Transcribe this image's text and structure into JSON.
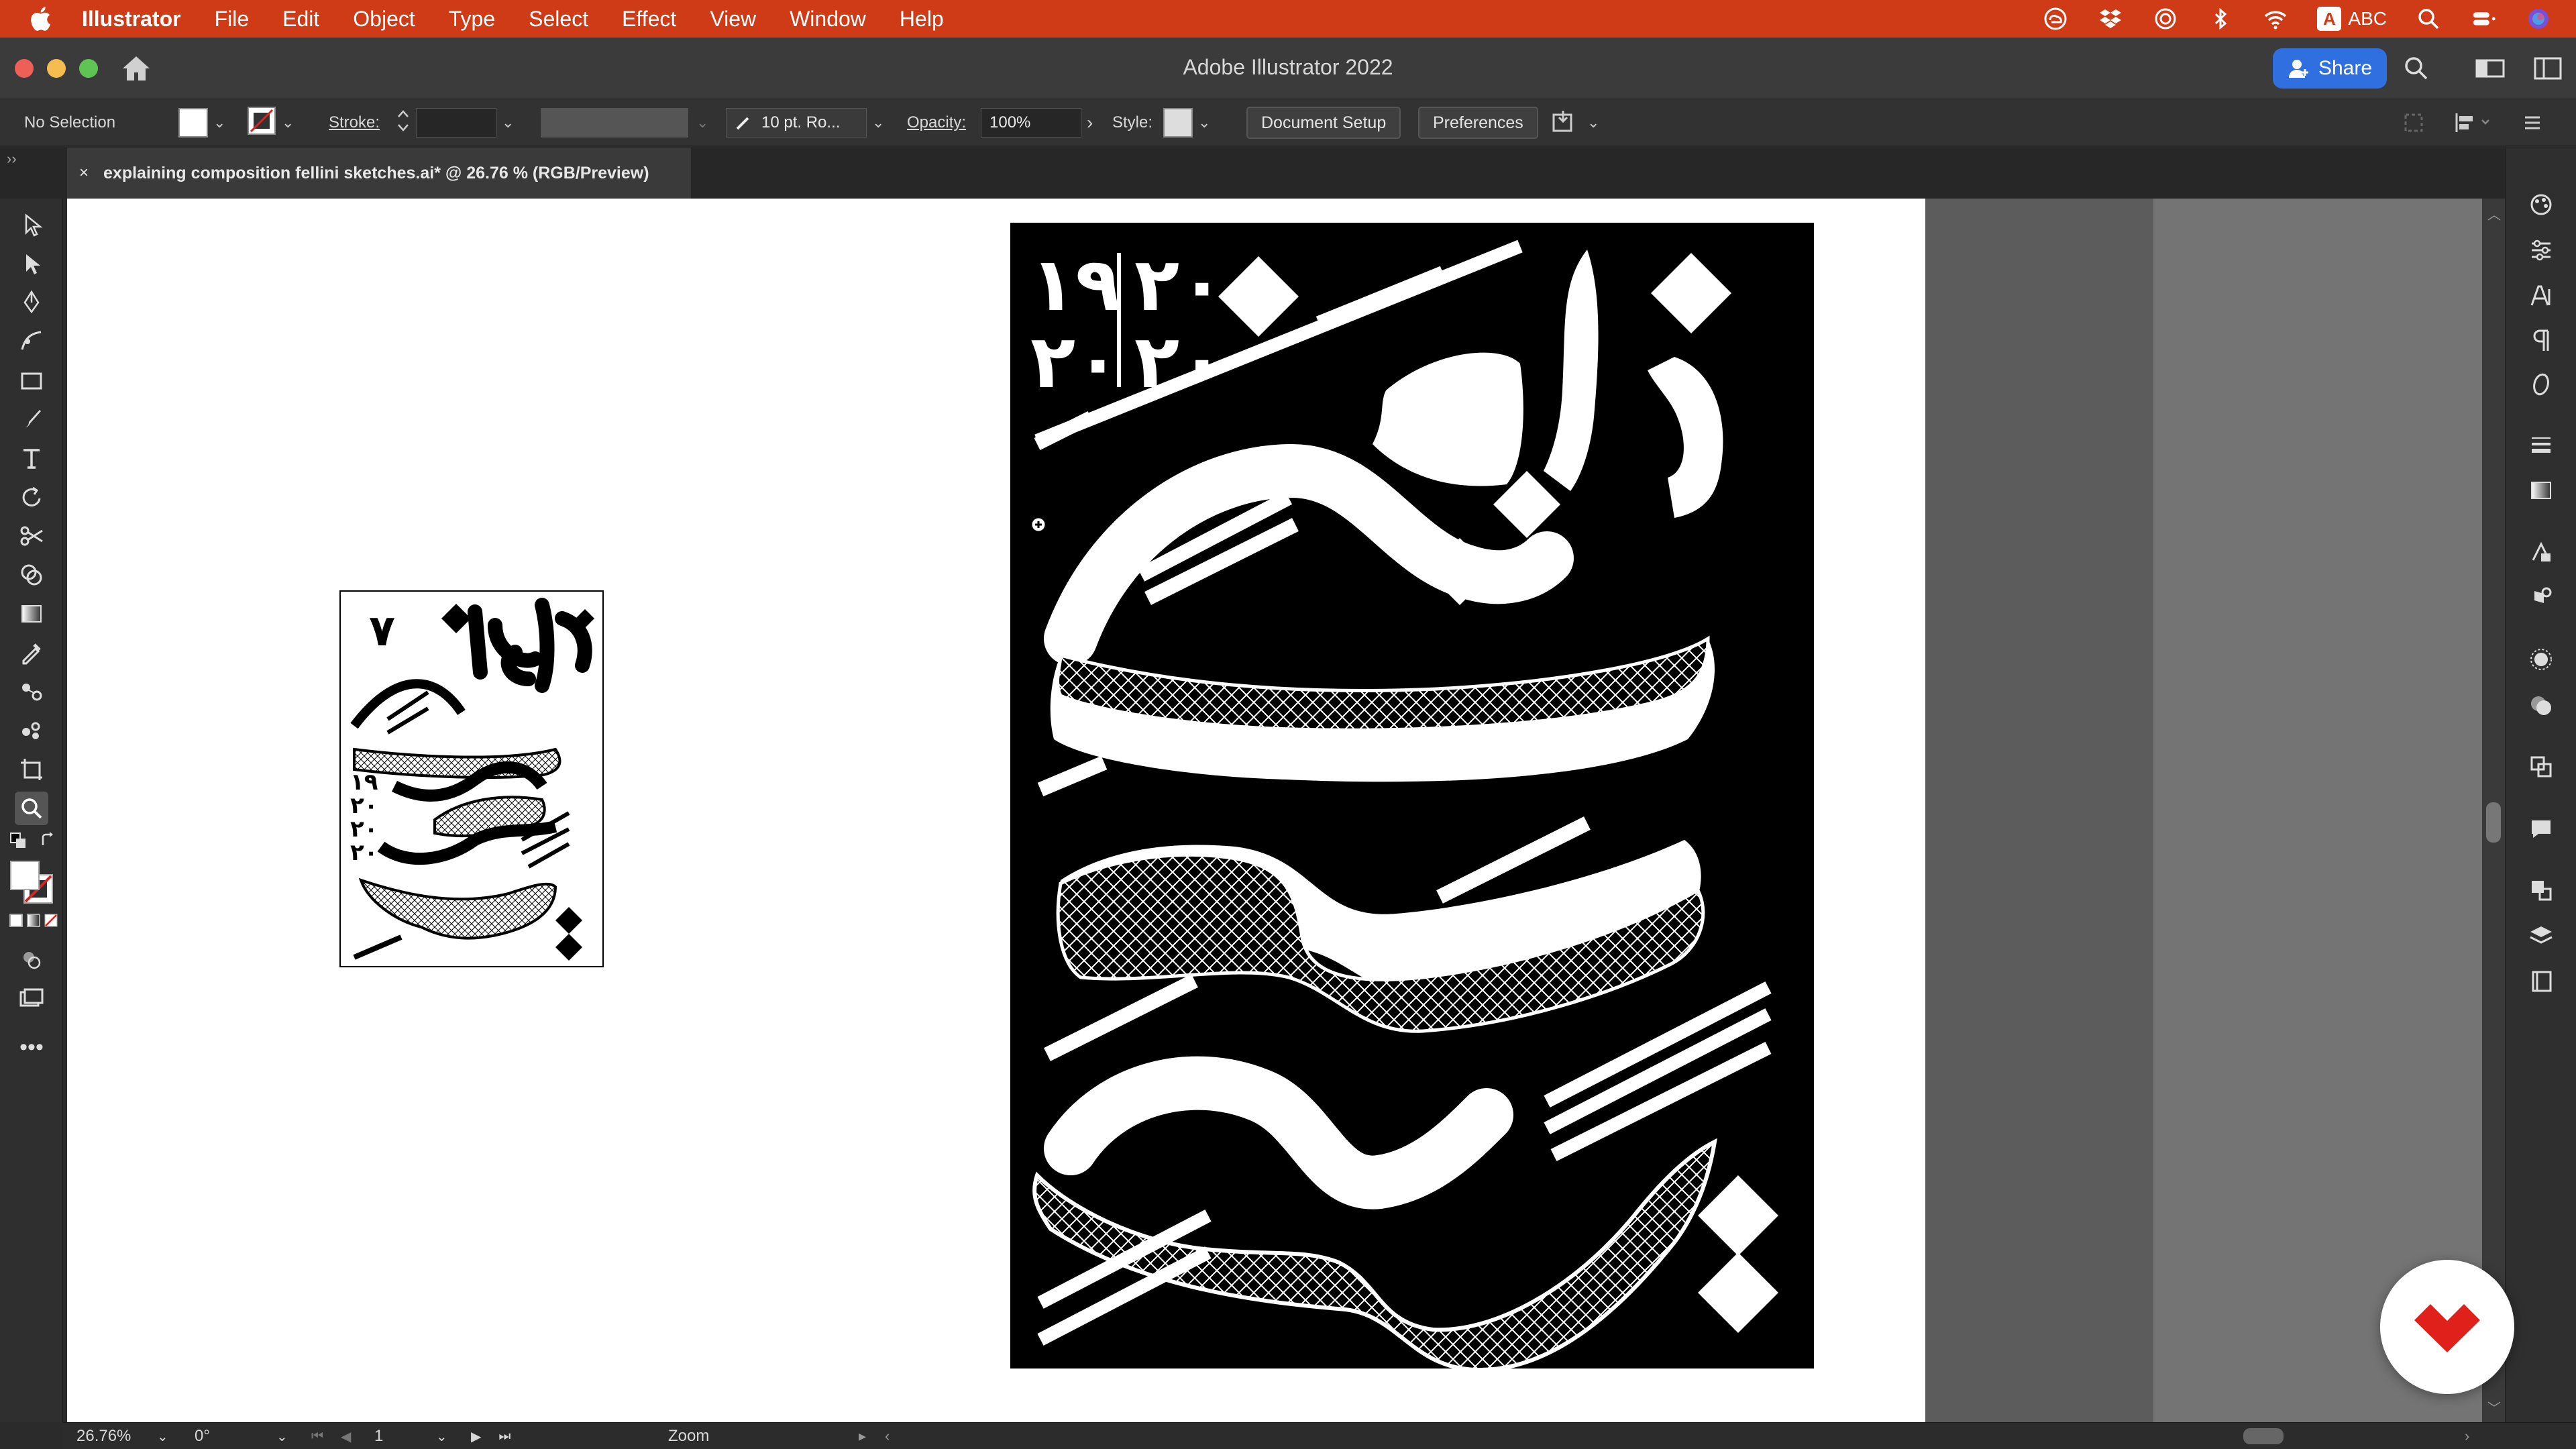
{
  "menubar": {
    "app_name": "Illustrator",
    "items": [
      "File",
      "Edit",
      "Object",
      "Type",
      "Select",
      "Effect",
      "View",
      "Window",
      "Help"
    ],
    "input_source": "ABC",
    "input_badge": "A"
  },
  "titlebar": {
    "title": "Adobe Illustrator 2022",
    "share_label": "Share"
  },
  "controlbar": {
    "selection_status": "No Selection",
    "stroke_label": "Stroke:",
    "brush_value": "10 pt. Ro...",
    "opacity_label": "Opacity:",
    "opacity_value": "100%",
    "style_label": "Style:",
    "document_setup_label": "Document Setup",
    "preferences_label": "Preferences"
  },
  "document_tab": {
    "title": "explaining composition fellini sketches.ai* @ 26.76 % (RGB/Preview)",
    "close_glyph": "×"
  },
  "statusbar": {
    "zoom": "26.76%",
    "rotation": "0°",
    "artboard_number": "1",
    "tool_name": "Zoom"
  },
  "artwork": {
    "poster_numerals_top_right": "٢٠",
    "poster_numerals_top_left": "١٩",
    "poster_numerals_bottom_right": "٢٠",
    "poster_numerals_bottom_left": "٢٠",
    "thumb_numeral": "٧",
    "thumb_year_lines": [
      "١٩",
      "٢٠",
      "٢٠",
      "٢٠"
    ]
  },
  "colors": {
    "menubar": "#cf3a17",
    "share_button": "#2f6fe0",
    "badge_red": "#e0201b"
  }
}
